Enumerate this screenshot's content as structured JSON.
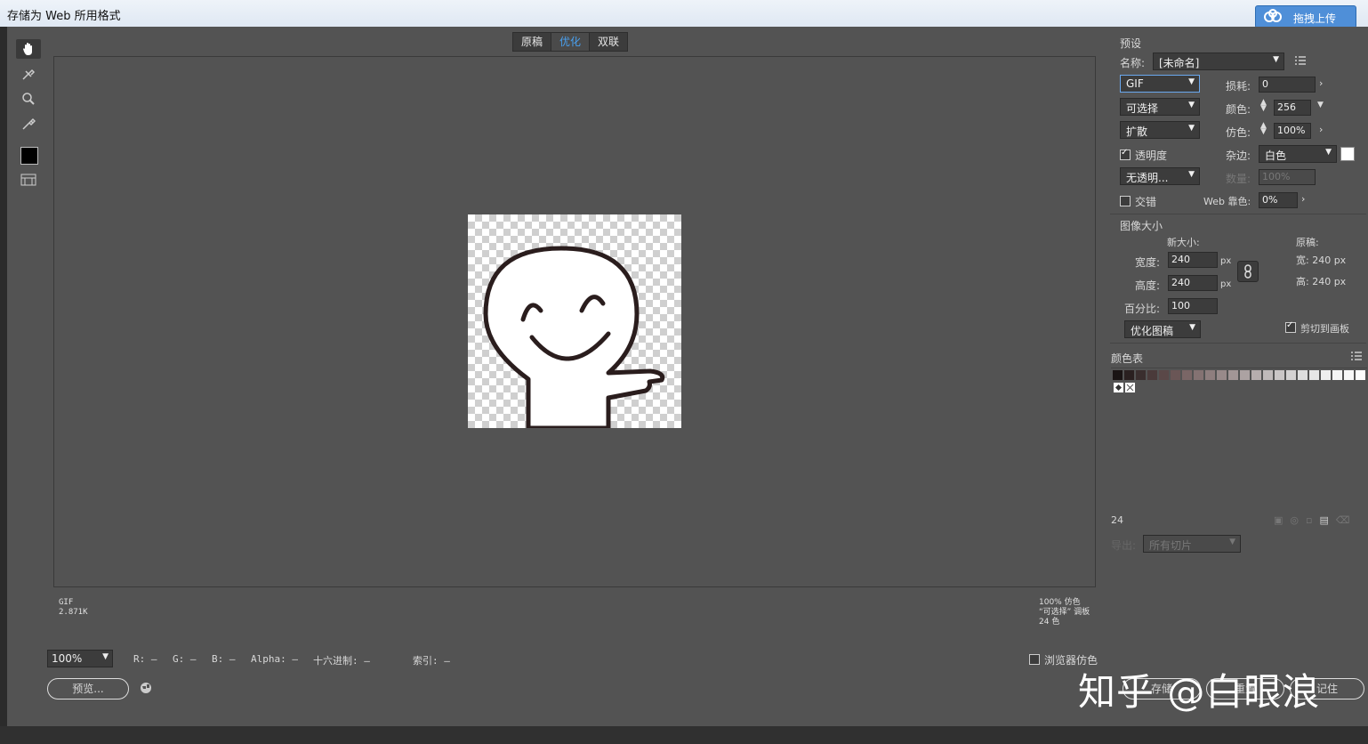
{
  "window": {
    "title": "存储为 Web 所用格式",
    "upload_label": "拖拽上传"
  },
  "tabs": [
    "原稿",
    "优化",
    "双联"
  ],
  "canvas_info": {
    "left_format": "GIF",
    "left_size": "2.871K",
    "right_line1": "100% 仿色",
    "right_line2": "“可选择” 调板",
    "right_line3": "24 色"
  },
  "bottom": {
    "zoom": "100%",
    "r": "R: —",
    "g": "G: —",
    "b": "B: —",
    "alpha": "Alpha: —",
    "hex": "十六进制: —",
    "index": "索引: —",
    "preview": "预览...",
    "browser_dither": "浏览器仿色",
    "save": "存储",
    "reset": "重置",
    "remember": "记住"
  },
  "watermark": "知乎 @白眼浪",
  "preset": {
    "section": "预设",
    "name_label": "名称:",
    "name_value": "[未命名]",
    "format": "GIF",
    "lossy_label": "损耗:",
    "lossy_value": "0",
    "palette": "可选择",
    "colors_label": "颜色:",
    "colors_value": "256",
    "dither_algo": "扩散",
    "dither_label": "仿色:",
    "dither_value": "100%",
    "transparency_label": "透明度",
    "matte_label": "杂边:",
    "matte_value": "白色",
    "trans_dither": "无透明...",
    "amount_label": "数量:",
    "amount_value": "100%",
    "interlaced_label": "交错",
    "websnap_label": "Web 靠色:",
    "websnap_value": "0%"
  },
  "image_size": {
    "section": "图像大小",
    "new_size": "新大小:",
    "original": "原稿:",
    "width_label": "宽度:",
    "width_value": "240",
    "height_label": "高度:",
    "height_value": "240",
    "unit": "px",
    "orig_width": "宽: 240 px",
    "orig_height": "高: 240 px",
    "percent_label": "百分比:",
    "percent_value": "100",
    "quality": "优化图稿",
    "clip_label": "剪切到画板"
  },
  "color_table": {
    "section": "颜色表",
    "count": "24",
    "export_label": "导出:",
    "export_value": "所有切片",
    "colors": [
      "#1a1414",
      "#2a2020",
      "#3a2e2e",
      "#4a3a3a",
      "#5a4848",
      "#6a5656",
      "#7a6666",
      "#847272",
      "#8e7e7e",
      "#988a8a",
      "#a29696",
      "#aca2a2",
      "#b6aeae",
      "#c0baba",
      "#cac6c6",
      "#d4d2d2",
      "#dedede",
      "#e6e6e6",
      "#eeeeee",
      "#f4f4f4",
      "#f8f8f8",
      "#fcfcfc"
    ]
  }
}
